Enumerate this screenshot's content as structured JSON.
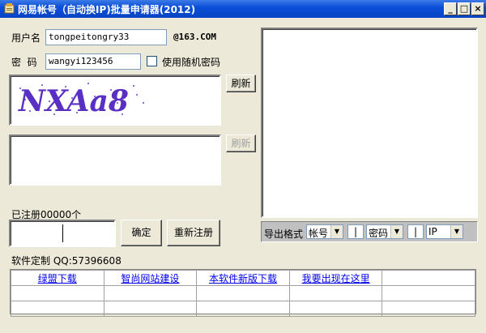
{
  "window": {
    "title": "网易帐号（自动换IP)批量申请器(2012)",
    "minimize": "_",
    "maximize": "□",
    "close": "×"
  },
  "form": {
    "username_label": "用户名",
    "username_value": "tongpeitongry33",
    "domain_suffix": "@163.COM",
    "password_label": "密  码",
    "password_value": "wangyi123456",
    "random_password_label": "使用随机密码",
    "refresh_label": "刷新",
    "refresh2_label": "刷新",
    "captcha_text": "NXAa8",
    "registered_label": "已注册00000个",
    "confirm_label": "确定",
    "reregister_label": "重新注册",
    "custom_label": "软件定制 QQ:57396608"
  },
  "export": {
    "label": "导出格式",
    "field1": "帐号",
    "sep1": "|",
    "field2": "密码",
    "sep2": "|",
    "field3": "IP"
  },
  "links": {
    "items": [
      "绿盟下载",
      "智尚网站建设",
      "本软件新版下载",
      "我要出现在这里",
      ""
    ]
  }
}
